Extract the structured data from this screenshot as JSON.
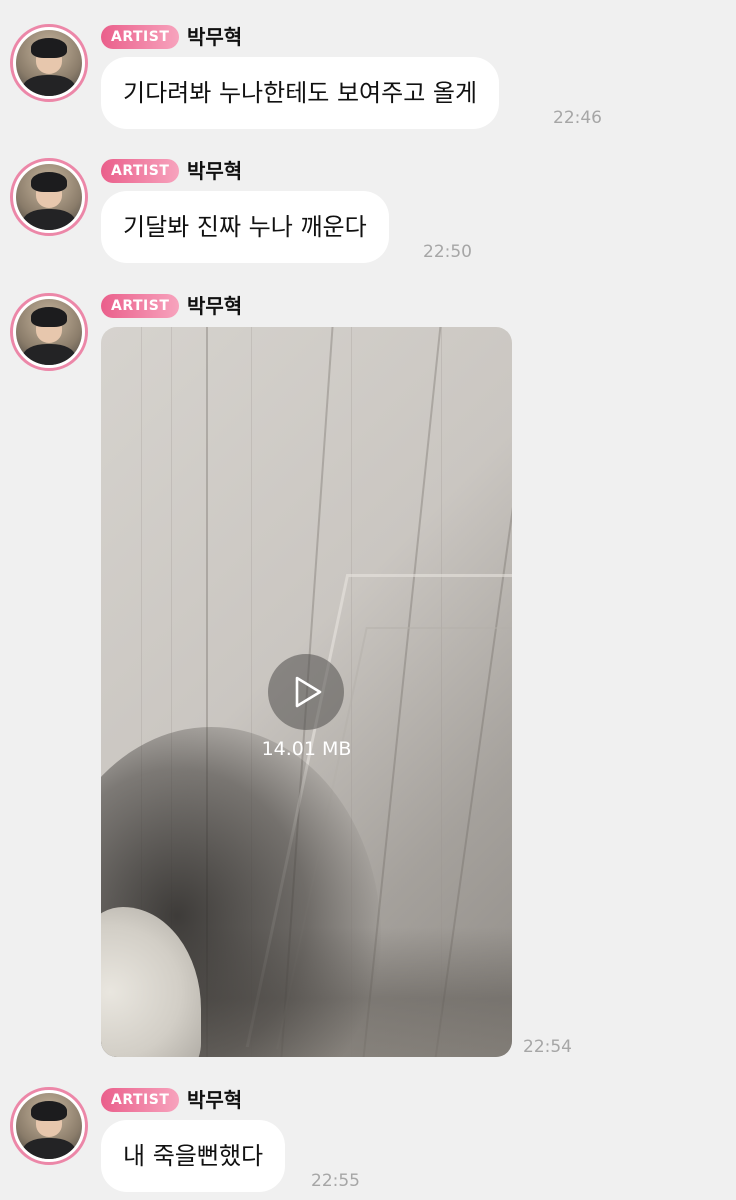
{
  "messages": [
    {
      "badge": "ARTIST",
      "name": "박무혁",
      "text": "기다려봐 누나한테도 보여주고 올게",
      "time": "22:46"
    },
    {
      "badge": "ARTIST",
      "name": "박무혁",
      "text": "기달봐 진짜 누나 깨운다",
      "time": "22:50"
    },
    {
      "badge": "ARTIST",
      "name": "박무혁",
      "video": {
        "file_size": "14.01 MB",
        "play_icon": "play-icon"
      },
      "time": "22:54"
    },
    {
      "badge": "ARTIST",
      "name": "박무혁",
      "text": "내 죽을뻔했다",
      "time": "22:55"
    }
  ],
  "colors": {
    "background": "#f0f0f0",
    "bubble": "#ffffff",
    "badge_start": "#ea5f8b",
    "badge_end": "#f7a3bd",
    "avatar_ring": "#ec87a8",
    "timestamp": "#a6a6a6"
  }
}
